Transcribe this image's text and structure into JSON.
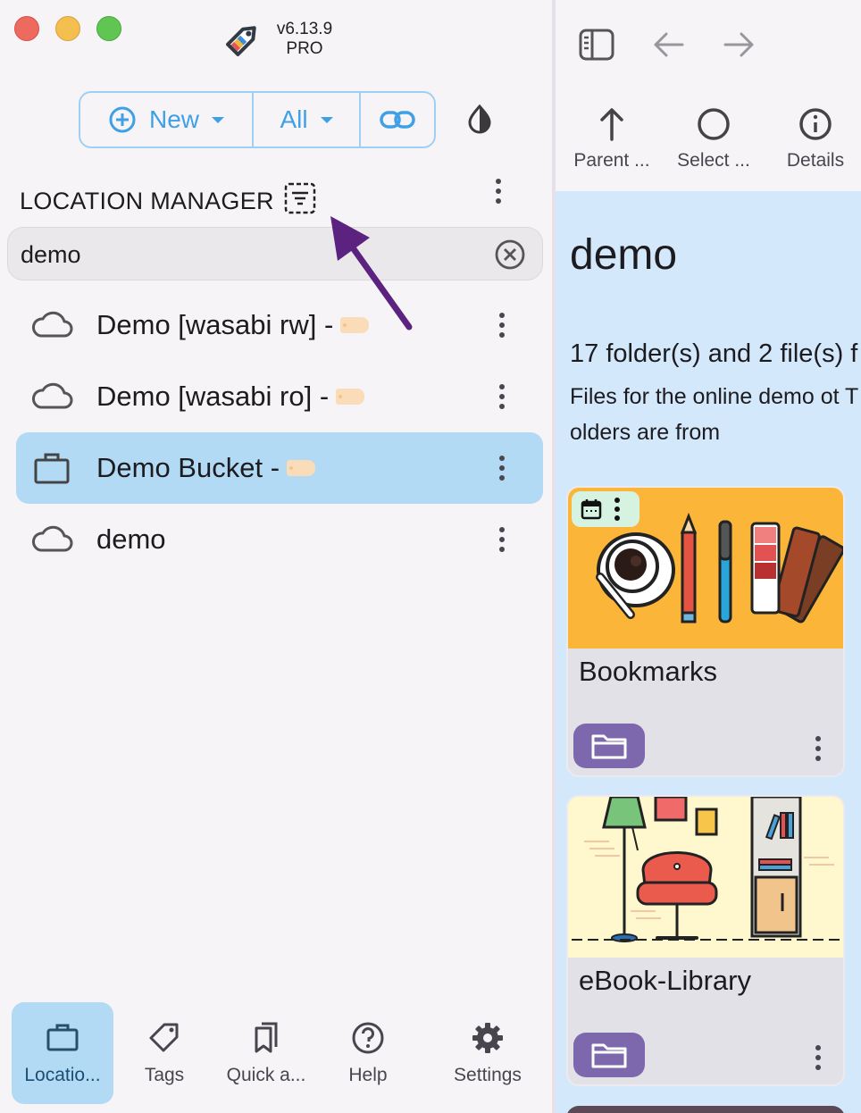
{
  "app": {
    "version": "v6.13.9",
    "edition": "PRO"
  },
  "toolbar": {
    "new_label": "New",
    "all_label": "All"
  },
  "location_manager": {
    "title": "LOCATION MANAGER",
    "search": {
      "value": "demo",
      "placeholder": ""
    },
    "locations": [
      {
        "label": "Demo [wasabi rw] -",
        "icon": "cloud-icon",
        "tagged": true,
        "selected": false
      },
      {
        "label": "Demo [wasabi ro] -",
        "icon": "cloud-icon",
        "tagged": true,
        "selected": false
      },
      {
        "label": "Demo Bucket -",
        "icon": "briefcase-icon",
        "tagged": true,
        "selected": true
      },
      {
        "label": "demo",
        "icon": "cloud-icon",
        "tagged": false,
        "selected": false
      }
    ]
  },
  "bottom_nav": {
    "items": [
      {
        "label": "Locatio...",
        "icon": "briefcase-icon",
        "active": true
      },
      {
        "label": "Tags",
        "icon": "tag-icon",
        "active": false
      },
      {
        "label": "Quick a...",
        "icon": "bookmarks-icon",
        "active": false
      },
      {
        "label": "Help",
        "icon": "help-icon",
        "active": false
      },
      {
        "label": "Settings",
        "icon": "gear-icon",
        "active": false
      }
    ]
  },
  "right_panel": {
    "actions": [
      {
        "label": "Parent ...",
        "icon": "arrow-up-icon"
      },
      {
        "label": "Select ...",
        "icon": "circle-icon"
      },
      {
        "label": "Details",
        "icon": "info-icon"
      }
    ],
    "folder": {
      "title": "demo",
      "stats": "17 folder(s) and 2 file(s) f",
      "description_line1": "Files for the online demo ot T",
      "description_line2": "olders are from"
    },
    "cards": [
      {
        "name": "Bookmarks",
        "thumb_bg": "#fbb63a"
      },
      {
        "name": "eBook-Library",
        "thumb_bg": "#fff8cf"
      }
    ]
  },
  "colors": {
    "accent_blue": "#3fa0e6",
    "selection": "#b2daf4",
    "folder_button": "#7d68ad",
    "annotation_arrow": "#5b237f"
  }
}
